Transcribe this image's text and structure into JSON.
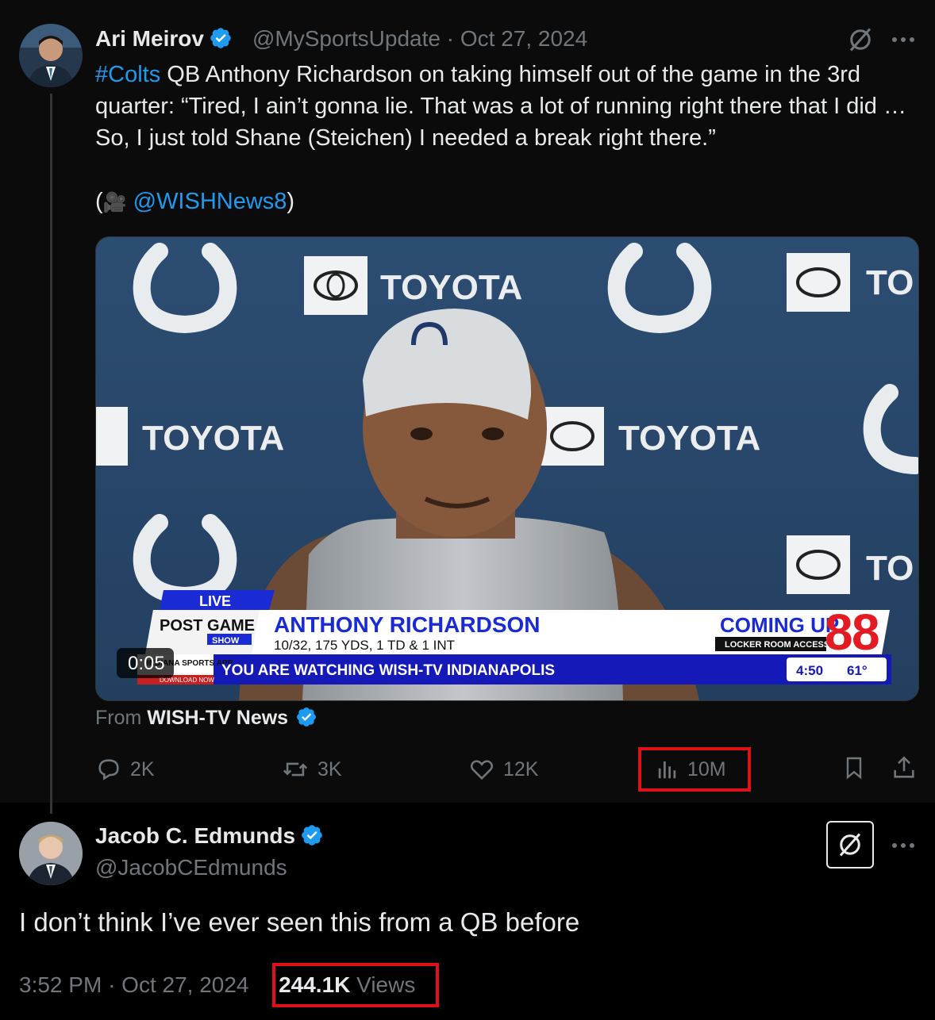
{
  "tweet1": {
    "author_name": "Ari Meirov",
    "handle": "@MySportsUpdate",
    "separator": "·",
    "date": "Oct 27, 2024",
    "text_hashtag": "#Colts",
    "text_body": " QB Anthony Richardson on taking himself out of the game in the 3rd quarter: “Tired, I ain’t gonna lie. That was a lot of running right there that I did … So, I just told Shane (Steichen) I needed a break right there.”",
    "credit_open": "(",
    "credit_emoji": "🎥",
    "credit_link": "@WISHNews8",
    "credit_close": ")",
    "media": {
      "sponsor_text": "TOYOTA",
      "sponsor_text_partial": "TO",
      "live_label": "LIVE",
      "show_label_1": "POST GAME",
      "show_label_2": "SHOW",
      "player_name": "ANTHONY RICHARDSON",
      "player_stats": "10/32, 175 YDS, 1 TD & 1 INT",
      "coming_up": "COMING UP",
      "coming_up_sub": "LOCKER ROOM ACCESS",
      "channel_number": "8",
      "ticker": "YOU ARE WATCHING WISH-TV INDIANAPOLIS",
      "app_label": "INDIANA SPORTS APP",
      "app_sub": "DOWNLOAD NOW",
      "clock": "4:50",
      "temperature": "61°",
      "timestamp": "0:05"
    },
    "from_prefix": "From",
    "from_source": "WISH-TV News",
    "actions": {
      "replies": "2K",
      "reposts": "3K",
      "likes": "12K",
      "views": "10M"
    }
  },
  "tweet2": {
    "author_name": "Jacob C. Edmunds",
    "handle": "@JacobCEdmunds",
    "text": "I don’t think I’ve ever seen this from a QB before",
    "time": "3:52 PM",
    "separator": "·",
    "date": "Oct 27, 2024",
    "views_count": "244.1K",
    "views_label": "Views"
  },
  "colors": {
    "background": "#000000",
    "tweet1_background": "#0b0b0b",
    "link": "#1d9bf0",
    "muted": "#71767b",
    "highlight": "#e0101a",
    "verified": "#1d9bf0"
  }
}
